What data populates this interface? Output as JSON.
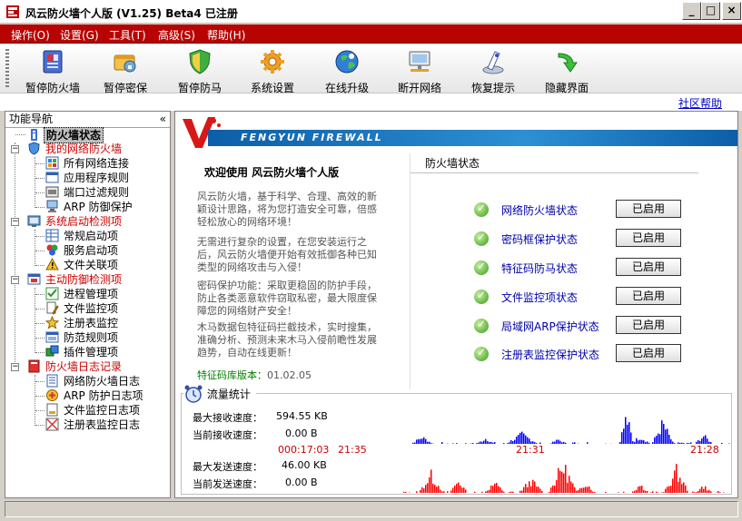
{
  "window": {
    "title": "风云防火墙个人版 (V1.25) Beta4 已注册",
    "buttons": {
      "minimize": "_",
      "maximize": "□",
      "close": "×"
    }
  },
  "menu": [
    {
      "label": "操作(O)"
    },
    {
      "label": "设置(G)"
    },
    {
      "label": "工具(T)"
    },
    {
      "label": "高级(S)"
    },
    {
      "label": "帮助(H)"
    }
  ],
  "toolbar": [
    {
      "label": "暂停防火墙",
      "icon": "firewall-icon"
    },
    {
      "label": "暂停密保",
      "icon": "password-protect-icon"
    },
    {
      "label": "暂停防马",
      "icon": "shield-icon"
    },
    {
      "label": "系统设置",
      "icon": "gear-icon"
    },
    {
      "label": "在线升级",
      "icon": "globe-update-icon"
    },
    {
      "label": "断开网络",
      "icon": "network-disconnect-icon"
    },
    {
      "label": "恢复提示",
      "icon": "restore-hint-icon"
    },
    {
      "label": "隐藏界面",
      "icon": "hide-arrow-icon"
    }
  ],
  "help_link": "社区帮助",
  "sidebar": {
    "title": "功能导航",
    "collapse": "«",
    "tree": [
      {
        "label": "防火墙状态",
        "level": 0,
        "selected": true
      },
      {
        "label": "我的网络防火墙",
        "level": 0,
        "category": true
      },
      {
        "label": "所有网络连接",
        "level": 1
      },
      {
        "label": "应用程序规则",
        "level": 1
      },
      {
        "label": "端口过滤规则",
        "level": 1
      },
      {
        "label": "ARP 防御保护",
        "level": 1
      },
      {
        "label": "系统启动检测项",
        "level": 0,
        "category": true
      },
      {
        "label": "常规启动项",
        "level": 1
      },
      {
        "label": "服务启动项",
        "level": 1
      },
      {
        "label": "文件关联项",
        "level": 1
      },
      {
        "label": "主动防御检测项",
        "level": 0,
        "category": true
      },
      {
        "label": "进程管理项",
        "level": 1
      },
      {
        "label": "文件监控项",
        "level": 1
      },
      {
        "label": "注册表监控",
        "level": 1
      },
      {
        "label": "防范规则项",
        "level": 1
      },
      {
        "label": "插件管理项",
        "level": 1
      },
      {
        "label": "防火墙日志记录",
        "level": 0,
        "category": true
      },
      {
        "label": "网络防火墙日志",
        "level": 1
      },
      {
        "label": "ARP 防护日志项",
        "level": 1
      },
      {
        "label": "文件监控日志项",
        "level": 1
      },
      {
        "label": "注册表监控日志",
        "level": 1
      }
    ]
  },
  "banner": {
    "text": "FENGYUN FIREWALL"
  },
  "welcome": {
    "title": "欢迎使用  风云防火墙个人版",
    "paragraphs": [
      "风云防火墙，基于科学、合理、高效的新颖设计思路，将为您打造安全可靠，倍感轻松放心的网络环境！",
      "无需进行复杂的设置，在您安装运行之后，风云防火墙便开始有效抵御各种已知类型的网络攻击与入侵！",
      "密码保护功能：采取更稳固的防护手段，防止各类恶意软件窃取私密，最大限度保障您的网络财产安全！",
      "木马数据包特征码拦截技术，实时搜集，准确分析、预测未来木马入侵前瞻性发展趋势，自动在线更新！"
    ],
    "version_label": "特征码库版本：",
    "version_value": "01.02.05"
  },
  "status": {
    "title": "防火墙状态",
    "items": [
      {
        "label": "网络防火墙状态",
        "button": "已启用"
      },
      {
        "label": "密码框保护状态",
        "button": "已启用"
      },
      {
        "label": "特征码防马状态",
        "button": "已启用"
      },
      {
        "label": "文件监控项状态",
        "button": "已启用"
      },
      {
        "label": "局域网ARP保护状态",
        "button": "已启用"
      },
      {
        "label": "注册表监控保护状态",
        "button": "已启用"
      }
    ]
  },
  "traffic": {
    "title": "流量统计",
    "max_recv_label": "最大接收速度：",
    "max_recv_value": "594.55 KB",
    "cur_recv_label": "当前接收速度：",
    "cur_recv_value": "0.00 B",
    "max_send_label": "最大发送速度：",
    "max_send_value": "46.00 KB",
    "cur_send_label": "当前发送速度：",
    "cur_send_value": "0.00 B",
    "time_elapsed": "000:17:03",
    "time_start": "21:35",
    "time_mid": "21:31",
    "time_end": "21:28",
    "recv_color": "#0000ff",
    "send_color": "#ff0000"
  }
}
